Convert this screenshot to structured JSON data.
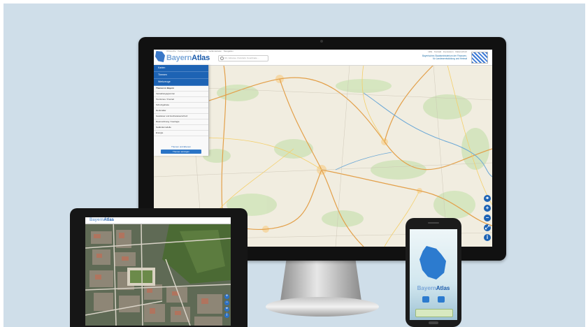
{
  "desktop": {
    "app_name_part1": "Bayern",
    "app_name_part2": "Atlas",
    "nav_links": "Ortssuche · Kartenansichten · Sachthemen · Geländedaten · Navigation",
    "search_placeholder": "Ort, Adresse, Flurstück, Koordinate ...",
    "top_links": "Hilfe · Kontakt · Impressum · Datenschutz",
    "ministry_lines": [
      "Bayerisches Staatsministerium der Finanzen,",
      "für Landesentwicklung und Heimat"
    ],
    "menu_items": [
      "Karten",
      "Themen",
      "Werkzeuge"
    ],
    "menu_section": "Themen in Bayern",
    "menu_subitems": [
      "Verwaltungsgrenzen",
      "Tourismus / Freizeit",
      "Schutzgebiete",
      "Denkmäler",
      "Gewässer und Hochwasserschutz",
      "Raumordnung / Geologie",
      "Geländemodelle",
      "Energie"
    ],
    "menu_link": "Themen und Ebenen",
    "menu_button": "Themen anzeigen",
    "map_controls": [
      "⌖",
      "+",
      "−",
      "⤢",
      "i"
    ]
  },
  "tablet": {
    "app_name_part1": "Bayern",
    "app_name_part2": "Atlas",
    "controls": [
      "+",
      "−",
      "⌖",
      "i"
    ]
  },
  "phone": {
    "app_name_part1": "Bayern",
    "app_name_part2": "Atlas"
  }
}
